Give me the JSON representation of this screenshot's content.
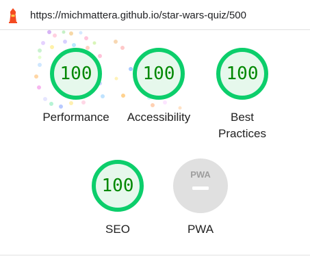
{
  "report": {
    "url": "https://michmattera.github.io/star-wars-quiz/500"
  },
  "colors": {
    "pass": "#0cce6b",
    "pass_fill": "#e6f8ec",
    "pass_text": "#008800",
    "pwa_gray": "#e0e0e0",
    "lighthouse_red": "#f44b21"
  },
  "icons": {
    "logo": "lighthouse-icon",
    "pwa": "pwa-badge-icon"
  },
  "gauges": [
    {
      "label": "Performance",
      "score": "100"
    },
    {
      "label": "Accessibility",
      "score": "100"
    },
    {
      "label": "Best Practices",
      "score": "100"
    },
    {
      "label": "SEO",
      "score": "100"
    },
    {
      "label": "PWA",
      "score": null
    }
  ],
  "pwa_badge_text": "PWA"
}
